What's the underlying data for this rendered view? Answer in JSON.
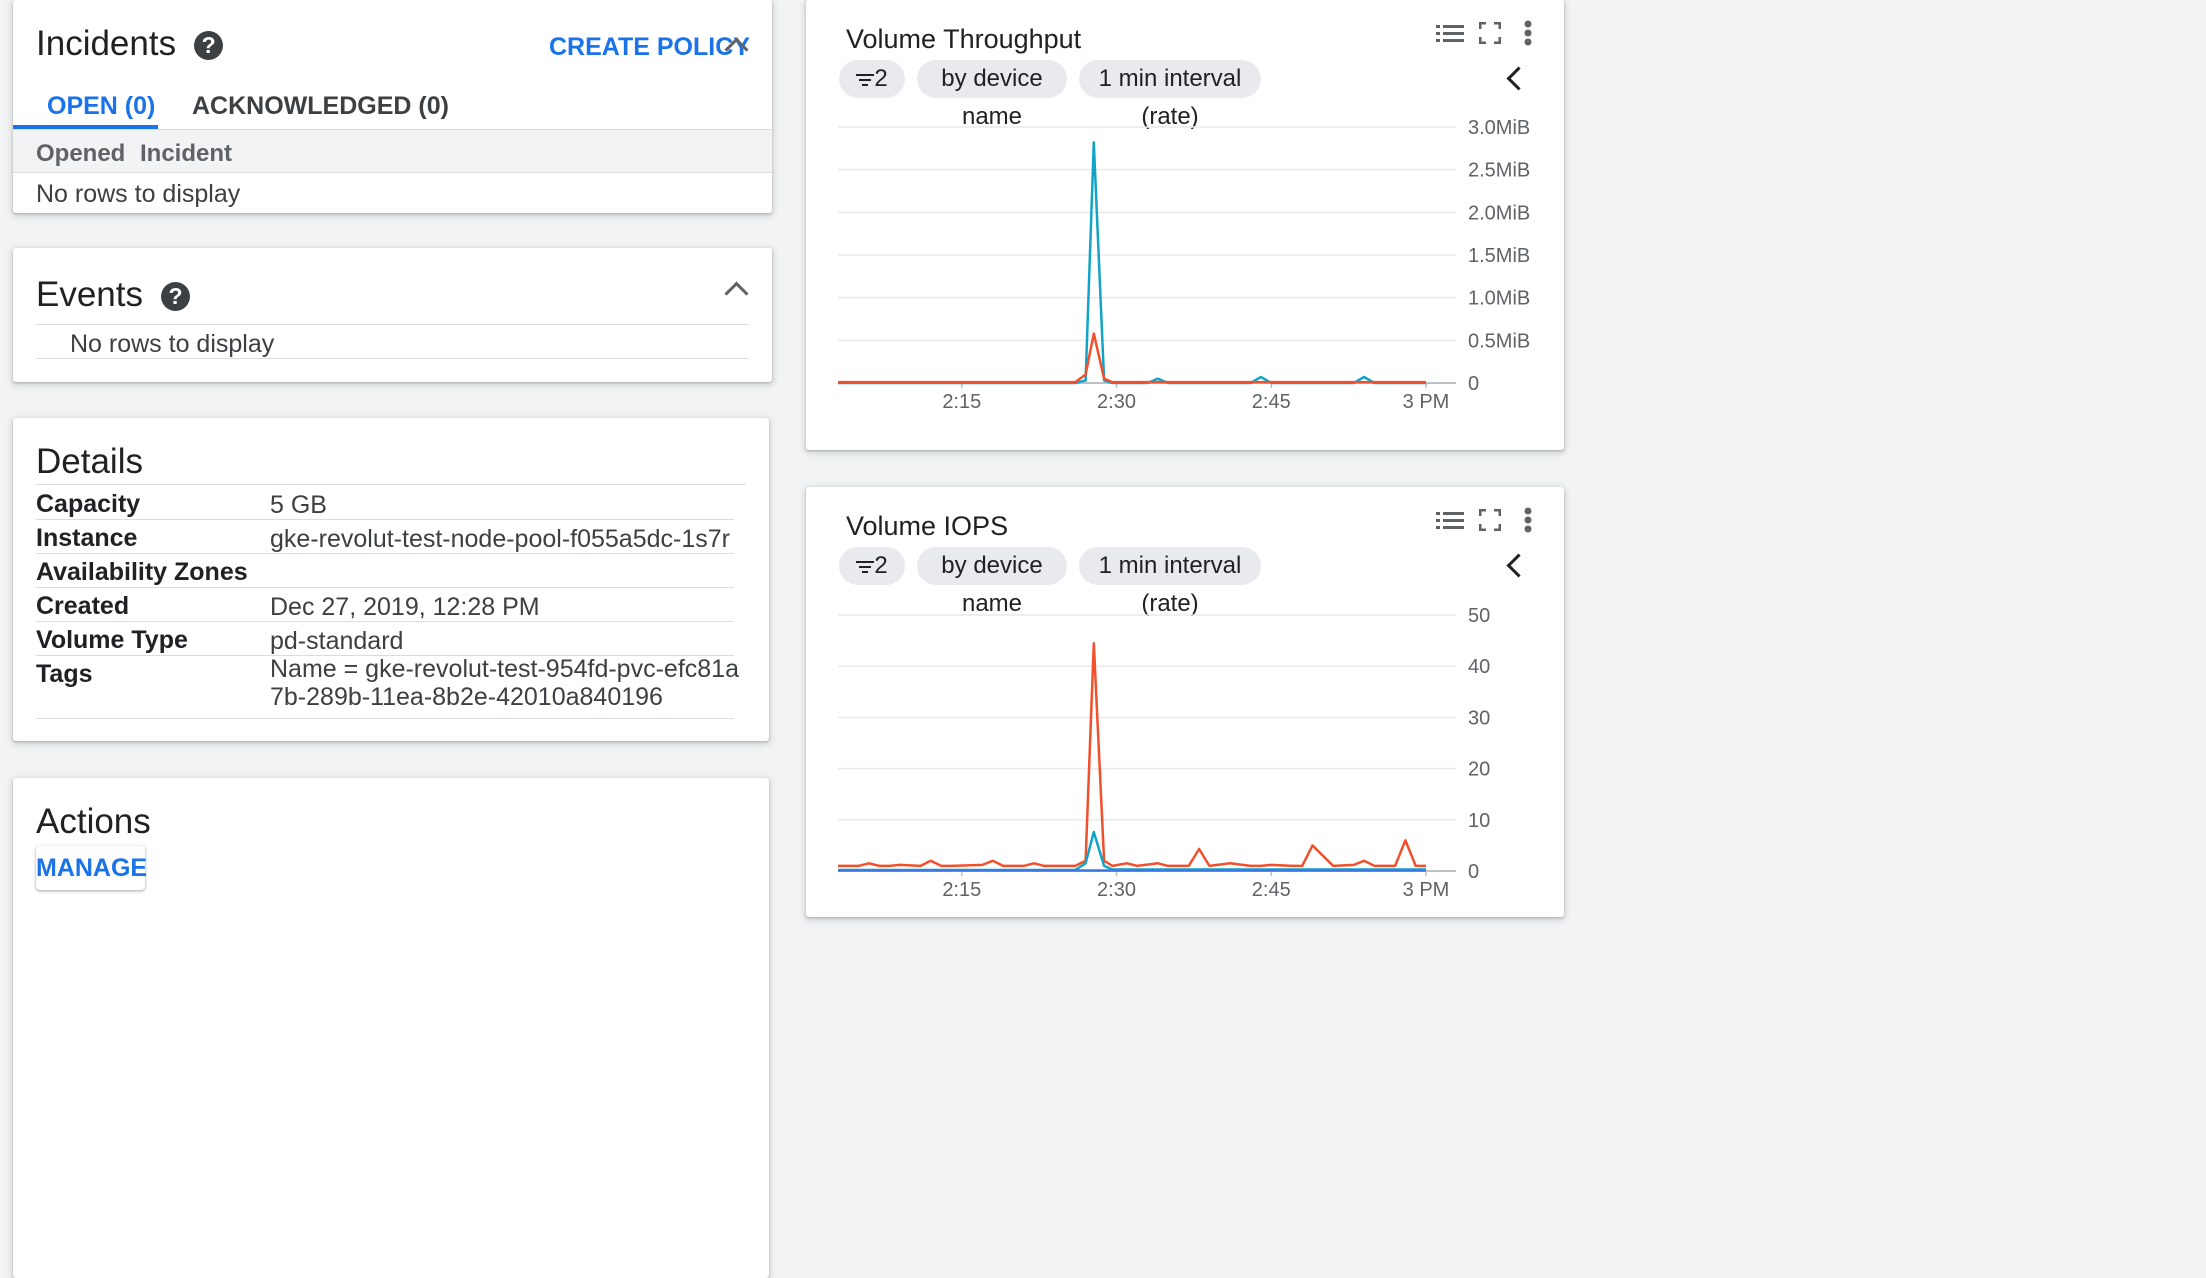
{
  "incidents": {
    "title": "Incidents",
    "create_policy": "CREATE POLICY",
    "tabs": [
      "OPEN (0)",
      "ACKNOWLEDGED (0)"
    ],
    "columns": [
      "Opened",
      "Incident"
    ],
    "empty": "No rows to display"
  },
  "events": {
    "title": "Events",
    "empty": "No rows to display"
  },
  "details": {
    "title": "Details",
    "rows": [
      {
        "label": "Capacity",
        "value": "5 GB"
      },
      {
        "label": "Instance",
        "value": "gke-revolut-test-node-pool-f055a5dc-1s7r"
      },
      {
        "label": "Availability Zones",
        "value": ""
      },
      {
        "label": "Created",
        "value": "Dec 27, 2019, 12:28 PM"
      },
      {
        "label": "Volume Type",
        "value": "pd-standard"
      },
      {
        "label": "Tags",
        "value": "Name = gke-revolut-test-954fd-pvc-efc81a7b-289b-11ea-8b2e-42010a840196"
      }
    ]
  },
  "actions": {
    "title": "Actions",
    "manage": "MANAGE"
  },
  "help_glyph": "?",
  "colors": {
    "accent": "#1a73e8",
    "series_teal": "#12a4c6",
    "series_orange": "#f0502c",
    "series_blue": "#3b78e7"
  },
  "chart_data": [
    {
      "type": "line",
      "title": "Volume Throughput",
      "chips": {
        "filter_count": "2",
        "group_by": "by device name",
        "interval": "1 min interval (rate)"
      },
      "x_ticks": [
        "2:15",
        "2:30",
        "2:45",
        "3 PM"
      ],
      "x_tick_minutes": [
        15,
        30,
        45,
        60
      ],
      "x_range_minutes": [
        3,
        60
      ],
      "y_ticks": [
        "0",
        "0.5MiB",
        "1.0MiB",
        "1.5MiB",
        "2.0MiB",
        "2.5MiB",
        "3.0MiB"
      ],
      "ylim": [
        0,
        3.0
      ],
      "y_unit": "MiB",
      "grid": true,
      "series": [
        {
          "color": "#12a4c6",
          "x": [
            3,
            26,
            27,
            27.8,
            28.8,
            29.6,
            33,
            34,
            35,
            43,
            44,
            45,
            53,
            54,
            55,
            60
          ],
          "values": [
            0,
            0,
            0.03,
            2.82,
            0.03,
            0,
            0,
            0.05,
            0,
            0,
            0.07,
            0,
            0,
            0.07,
            0,
            0
          ]
        },
        {
          "color": "#f0502c",
          "x": [
            3,
            26,
            27,
            27.8,
            28.8,
            29.6,
            60
          ],
          "values": [
            0.01,
            0.01,
            0.1,
            0.58,
            0.05,
            0.01,
            0.01
          ]
        }
      ]
    },
    {
      "type": "line",
      "title": "Volume IOPS",
      "chips": {
        "filter_count": "2",
        "group_by": "by device name",
        "interval": "1 min interval (rate)"
      },
      "x_ticks": [
        "2:15",
        "2:30",
        "2:45",
        "3 PM"
      ],
      "x_tick_minutes": [
        15,
        30,
        45,
        60
      ],
      "x_range_minutes": [
        3,
        60
      ],
      "y_ticks": [
        "0",
        "10",
        "20",
        "30",
        "40",
        "50"
      ],
      "ylim": [
        0,
        50
      ],
      "grid": true,
      "series": [
        {
          "color": "#f0502c",
          "x": [
            3,
            5,
            6,
            7,
            8,
            9,
            11,
            12,
            13,
            14,
            17,
            18,
            19,
            21,
            22,
            23,
            26,
            27,
            27.8,
            28.8,
            29.6,
            31,
            32,
            34,
            35,
            37,
            38,
            39,
            41,
            43,
            44,
            45,
            47,
            48,
            49,
            51,
            53,
            54,
            55,
            57,
            58,
            59,
            60
          ],
          "values": [
            1,
            1,
            1.5,
            1,
            1,
            1.2,
            1,
            2,
            1,
            1,
            1.2,
            2,
            1,
            1,
            1.5,
            1,
            1,
            2,
            44.5,
            2,
            1,
            1.5,
            1,
            1.5,
            1,
            1,
            4.3,
            1,
            1.5,
            1,
            1,
            1.2,
            1,
            1,
            5,
            1,
            1.2,
            2,
            1,
            1,
            6,
            1,
            1
          ]
        },
        {
          "color": "#12a4c6",
          "x": [
            3,
            26,
            27,
            27.8,
            28.8,
            29.6,
            60
          ],
          "values": [
            0.2,
            0.2,
            1.5,
            7.6,
            1,
            0.3,
            0.3
          ]
        },
        {
          "color": "#3b78e7",
          "x": [
            3,
            60
          ],
          "values": [
            0.1,
            0.1
          ]
        }
      ]
    }
  ]
}
